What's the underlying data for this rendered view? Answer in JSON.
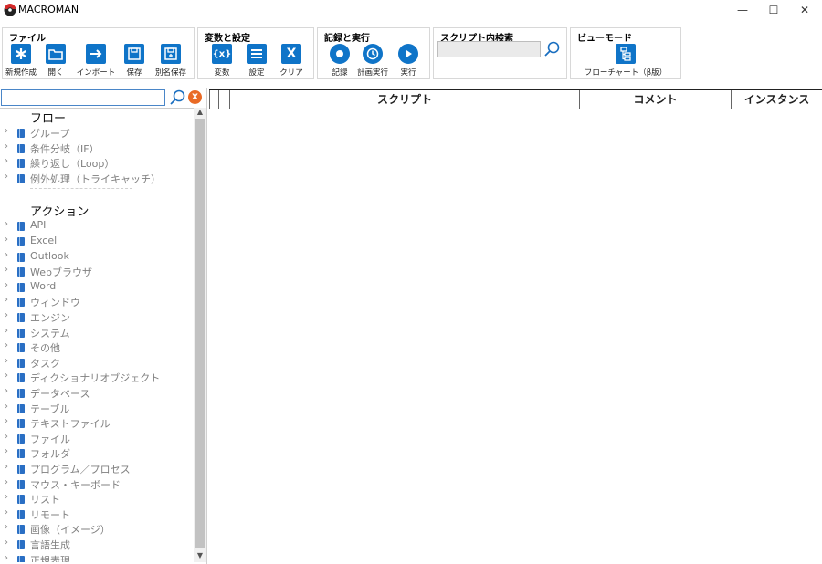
{
  "window": {
    "title": "MACROMAN",
    "minimize": "—",
    "maximize": "☐",
    "close": "✕"
  },
  "ribbon": {
    "file": {
      "label": "ファイル",
      "buttons": [
        "新規作成",
        "開く",
        "インポート",
        "保存",
        "別名保存"
      ]
    },
    "vars": {
      "label": "変数と設定",
      "buttons": [
        "変数",
        "設定",
        "クリア"
      ],
      "var_glyph": "{x}",
      "clear_glyph": "X"
    },
    "record": {
      "label": "記録と実行",
      "buttons": [
        "記録",
        "計画実行",
        "実行"
      ]
    },
    "search": {
      "label": "スクリプト内検索",
      "value": ""
    },
    "view": {
      "label": "ビューモード",
      "buttons": [
        "フローチャート（β版）"
      ]
    }
  },
  "left": {
    "filter_value": "",
    "clear_glyph": "X",
    "sections": [
      {
        "title": "フロー",
        "items": [
          "グループ",
          "条件分岐（IF）",
          "繰り返し（Loop）",
          "例外処理（トライキャッチ）"
        ]
      },
      {
        "title": "アクション",
        "items": [
          "API",
          "Excel",
          "Outlook",
          "Webブラウザ",
          "Word",
          "ウィンドウ",
          "エンジン",
          "システム",
          "その他",
          "タスク",
          "ディクショナリオブジェクト",
          "データベース",
          "テーブル",
          "テキストファイル",
          "ファイル",
          "フォルダ",
          "プログラム／プロセス",
          "マウス・キーボード",
          "リスト",
          "リモート",
          "画像（イメージ）",
          "言語生成",
          "正規表現"
        ]
      }
    ]
  },
  "grid": {
    "columns": [
      "",
      "",
      "スクリプト",
      "コメント",
      "インスタンス"
    ]
  },
  "colors": {
    "accent": "#0f74c8",
    "clear": "#e96a25"
  },
  "icons": [
    "new-icon",
    "open-folder-icon",
    "import-arrow-icon",
    "save-icon",
    "save-as-icon",
    "variable-icon",
    "settings-list-icon",
    "clear-icon",
    "record-icon",
    "schedule-icon",
    "play-icon",
    "search-icon",
    "flowchart-icon",
    "book-icon",
    "chevron-right-icon"
  ]
}
